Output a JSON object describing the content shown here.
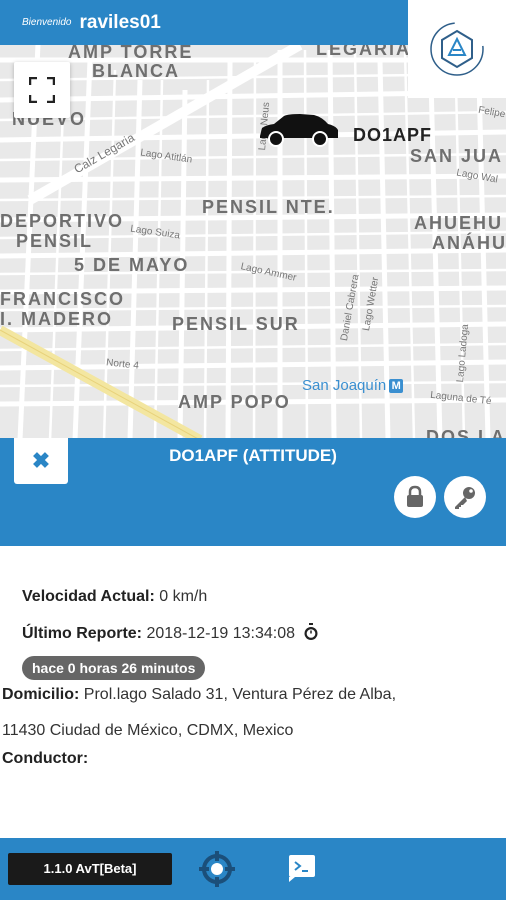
{
  "header": {
    "welcome": "Bienvenido",
    "username": "raviles01"
  },
  "map": {
    "neighborhoods": [
      "AMP TORRE",
      "BLANCA",
      "LEGARIA",
      "NUEVO",
      "SAN JUA",
      "PENSIL NTE.",
      "DEPORTIVO",
      "PENSIL",
      "AHUEHU",
      "ANÁHU",
      "5 DE MAYO",
      "FRANCISCO",
      "I. MADERO",
      "PENSIL SUR",
      "AMP POPO",
      "DOS LA"
    ],
    "streets": [
      "Calz Legaria",
      "Lago Atitlán",
      "Lago Suiza",
      "Lago Ammer",
      "Daniel Cabrera",
      "Lago Wetter",
      "Lago Ladoga",
      "Laguna de Té",
      "Norte 4",
      "Lago Neus",
      "Felipe",
      "Lago Wal"
    ],
    "metro_station": "San Joaquín",
    "metro_symbol": "M",
    "vehicle_marker_label": "DO1APF"
  },
  "panel": {
    "close_symbol": "✖",
    "title": "DO1APF (ATTITUDE)"
  },
  "details": {
    "speed_label": "Velocidad Actual:",
    "speed_value": "0 km/h",
    "report_label": "Último Reporte:",
    "report_value": "2018-12-19 13:34:08",
    "elapsed_badge": "hace 0 horas 26 minutos",
    "address_label": "Domicilio:",
    "address_line1": "Prol.lago Salado 31, Ventura Pérez de Alba,",
    "address_line2": "11430 Ciudad de México, CDMX, Mexico",
    "driver_label": "Conductor:"
  },
  "footer": {
    "version": "1.1.0 AvT[Beta]"
  },
  "colors": {
    "primary": "#2a86c6",
    "map_bg": "#e8e8e8",
    "road_major": "#f3e6a0",
    "badge": "#666666"
  },
  "icons": [
    "fullscreen-icon",
    "car-icon",
    "app-logo-icon",
    "close-icon",
    "lock-icon",
    "key-icon",
    "stopwatch-icon",
    "crosshair-target-icon",
    "terminal-icon",
    "metro-icon"
  ]
}
